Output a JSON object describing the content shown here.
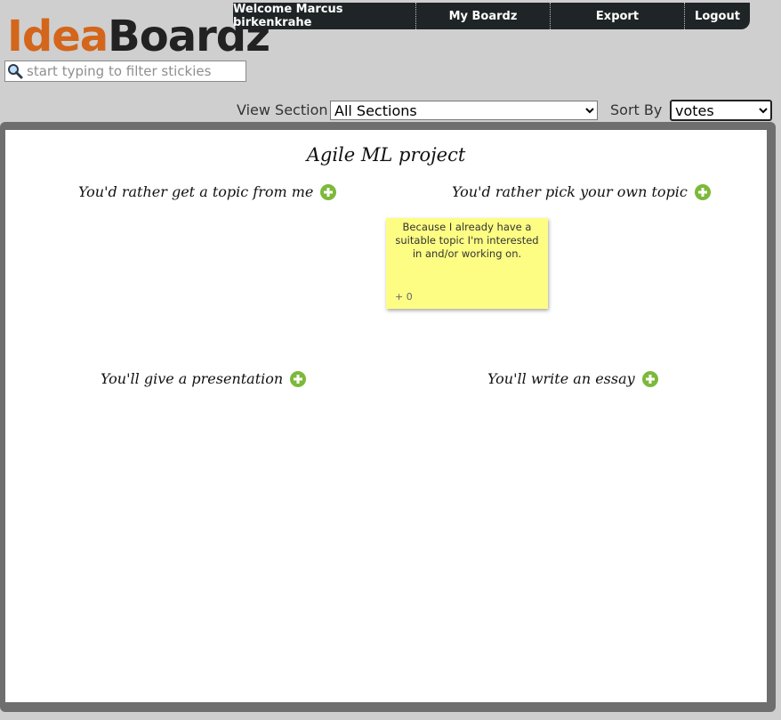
{
  "logo": {
    "part1": "Idea",
    "part2": "Boardz",
    "color_idea": "#d3661b",
    "color_boardz": "#222222"
  },
  "nav": {
    "welcome": "Welcome Marcus birkenkrahe",
    "my_boardz": "My Boardz",
    "export": "Export",
    "logout": "Logout"
  },
  "search": {
    "placeholder": "start typing to filter stickies",
    "value": "",
    "icon": "magnifier-icon"
  },
  "controls": {
    "view_section_label": "View Section",
    "view_section_value": "All Sections",
    "sort_by_label": "Sort By",
    "sort_by_value": "votes"
  },
  "board": {
    "title": "Agile ML project",
    "sections": [
      {
        "title": "You'd rather get a topic from me",
        "icon": "add-icon"
      },
      {
        "title": "You'd rather pick your own topic",
        "icon": "add-icon"
      },
      {
        "title": "You'll give a presentation",
        "icon": "add-icon"
      },
      {
        "title": "You'll write an essay",
        "icon": "add-icon"
      }
    ],
    "stickies": [
      {
        "text": "Because I already have a suitable topic I'm interested in and/or working on.",
        "votes": "+ 0",
        "color": "#fdfd84"
      }
    ]
  },
  "colors": {
    "accent_green": "#7cb93a",
    "nav_bg": "#1f2527",
    "frame": "#6e6e6e"
  }
}
